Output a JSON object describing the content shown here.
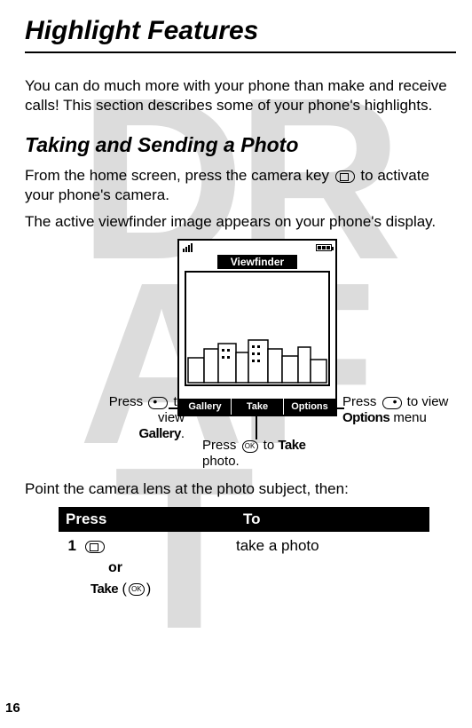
{
  "watermark": "DRAFT",
  "page_number": "16",
  "title": "Highlight Features",
  "intro": "You can do much more with your phone than make and receive calls! This section describes some of your phone's highlights.",
  "section_heading": "Taking and Sending a Photo",
  "para1_a": "From the home screen, press the camera key ",
  "para1_b": " to activate your phone's camera.",
  "para2": "The active viewfinder image appears on your phone's display.",
  "viewfinder_label": "Viewfinder",
  "softkeys": {
    "left": "Gallery",
    "center": "Take",
    "right": "Options"
  },
  "callout_left_a": "Press ",
  "callout_left_b": " to view ",
  "callout_left_c": "Gallery",
  "callout_left_d": ".",
  "callout_right_a": "Press ",
  "callout_right_b": " to view ",
  "callout_right_c": "Options",
  "callout_right_d": " menu",
  "callout_bottom_a": "Press ",
  "callout_bottom_b": " to ",
  "callout_bottom_c": "Take",
  "callout_bottom_d": " photo.",
  "point_text": "Point the camera lens at the photo subject, then:",
  "table": {
    "head_press": "Press",
    "head_to": "To",
    "row1_num": "1",
    "row1_to": "take a photo",
    "or": "or",
    "take_label": "Take",
    "ok_label": "OK"
  }
}
